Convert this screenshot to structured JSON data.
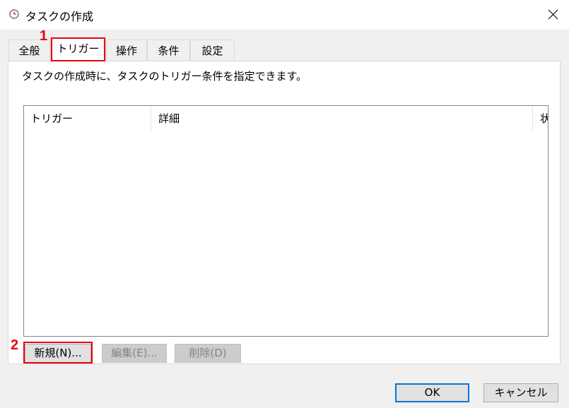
{
  "window": {
    "title": "タスクの作成",
    "icon": "clock-icon"
  },
  "tabs": [
    {
      "label": "全般"
    },
    {
      "label": "トリガー",
      "active": true
    },
    {
      "label": "操作"
    },
    {
      "label": "条件"
    },
    {
      "label": "設定"
    }
  ],
  "panel": {
    "description": "タスクの作成時に、タスクのトリガー条件を指定できます。",
    "columns": [
      "トリガー",
      "詳細",
      "状"
    ],
    "buttons": {
      "new": "新規(N)...",
      "edit": "編集(E)...",
      "delete": "削除(D)"
    }
  },
  "annotations": {
    "step1": "1",
    "step2": "2",
    "color": "#e8000b"
  },
  "dialog_buttons": {
    "ok": "OK",
    "cancel": "キャンセル"
  }
}
